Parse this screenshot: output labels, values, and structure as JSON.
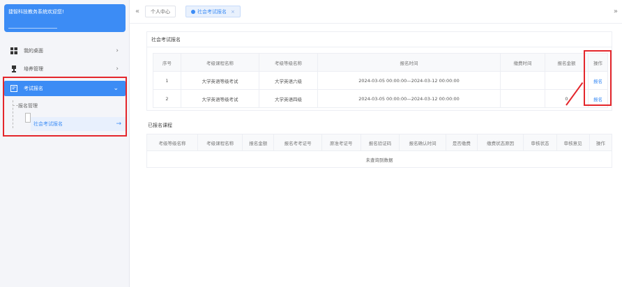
{
  "sidebar": {
    "brand_text": "捷智科技教务系统欢迎您!",
    "items": [
      {
        "label": "我的桌面",
        "icon": "windows-icon"
      },
      {
        "label": "培养管理",
        "icon": "trophy-icon"
      },
      {
        "label": "考试报名",
        "icon": "exam-icon"
      }
    ],
    "sub_group_label": "报名管理",
    "sub_active_label": "社会考试报名"
  },
  "tabs": {
    "prev": "«",
    "items": [
      {
        "label": "个人中心",
        "active": false
      },
      {
        "label": "社会考试报名",
        "active": true
      }
    ],
    "close": "×",
    "next": "»"
  },
  "exam_section": {
    "title": "社会考试报名",
    "headers": [
      "序号",
      "考级课程名称",
      "考级等级名称",
      "报名时间",
      "缴费时间",
      "报名金额",
      "操作"
    ],
    "rows": [
      {
        "seq": "1",
        "course": "大学英语等级考试",
        "level": "大学英语六级",
        "time": "2024-03-05 00:00:00—2024-03-12 00:00:00",
        "pay_time": "",
        "amount": "",
        "action": "报名"
      },
      {
        "seq": "2",
        "course": "大学英语等级考试",
        "level": "大学英语四级",
        "time": "2024-03-05 00:00:00—2024-03-12 00:00:00",
        "pay_time": "",
        "amount": "0",
        "action": "报名"
      }
    ]
  },
  "enrolled_section": {
    "title": "已报名课程",
    "headers": [
      "考级等级名称",
      "考级课程名称",
      "报名金额",
      "报名考考证号",
      "原准考证号",
      "报名验证码",
      "报名确认时间",
      "是否缴费",
      "缴费状态原因",
      "审核状态",
      "审核意见",
      "操作"
    ],
    "empty_text": "未查询到数据"
  },
  "colors": {
    "accent": "#3c8cf5",
    "highlight": "#e4262b"
  }
}
